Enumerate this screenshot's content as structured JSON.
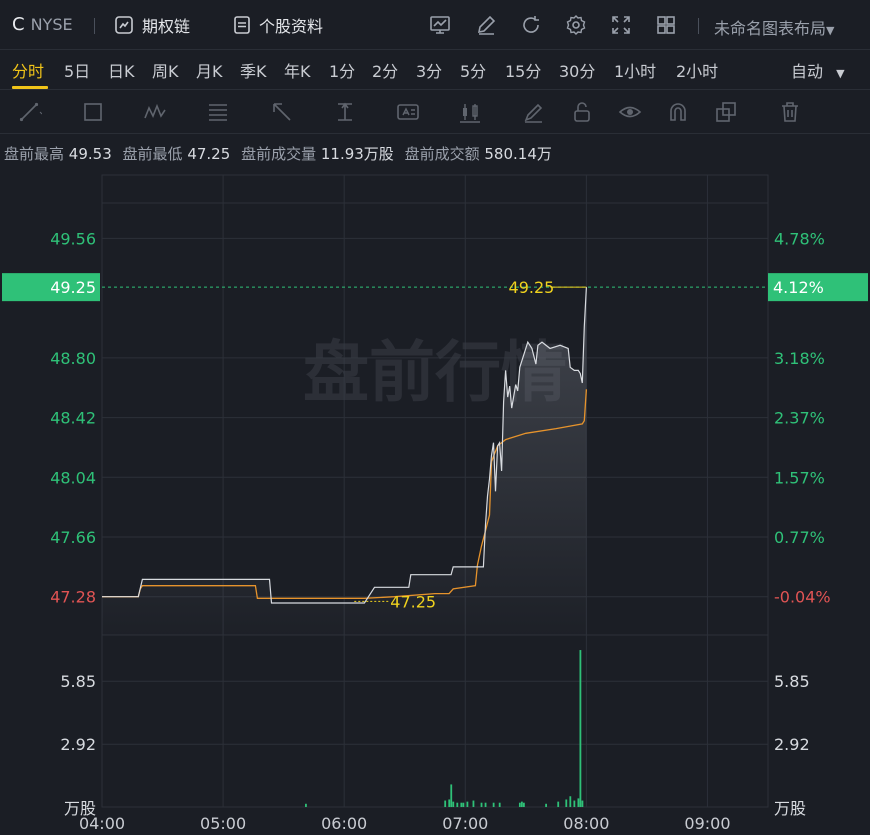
{
  "header": {
    "ticker": "C",
    "exchange": "NYSE",
    "options_label": "期权链",
    "profile_label": "个股资料",
    "layout_name": "未命名图表布局"
  },
  "timeframes": [
    "分时",
    "5日",
    "日K",
    "周K",
    "月K",
    "季K",
    "年K",
    "1分",
    "2分",
    "3分",
    "5分",
    "15分",
    "30分",
    "1小时",
    "2小时"
  ],
  "active_timeframe": 0,
  "scale_mode": "自动",
  "premarket": {
    "high_label": "盘前最高",
    "high": "49.53",
    "low_label": "盘前最低",
    "low": "47.25",
    "volume_label": "盘前成交量",
    "volume": "11.93万股",
    "amount_label": "盘前成交额",
    "amount": "580.14万"
  },
  "watermark": "盘前行情",
  "colors": {
    "background": "#1b1e25",
    "grid": "#2c3039",
    "up": "#2fc178",
    "down": "#e05454",
    "price_line": "#d8dbe0",
    "avg_line": "#e6932c",
    "label_yellow": "#f0d21e",
    "volume_bar": "#2fc178"
  },
  "chart_data": {
    "type": "line",
    "price_ticks": [
      "49.56",
      "48.80",
      "48.42",
      "48.04",
      "47.66",
      "47.28"
    ],
    "price_tick_values": [
      49.56,
      48.8,
      48.42,
      48.04,
      47.66,
      47.28
    ],
    "pct_ticks": [
      "4.78%",
      "3.18%",
      "2.37%",
      "1.57%",
      "0.77%",
      "-0.04%"
    ],
    "current_price": "49.25",
    "current_pct": "4.12%",
    "high_marker": "49.25",
    "low_marker": "47.25",
    "volume_ticks": [
      "5.85",
      "2.92"
    ],
    "volume_tick_values": [
      5.85,
      2.92
    ],
    "volume_unit": "万股",
    "time_ticks": [
      "04:00",
      "05:00",
      "06:00",
      "07:00",
      "08:00",
      "09:00"
    ],
    "time_tick_minutes": [
      240,
      300,
      360,
      420,
      480,
      540
    ],
    "x_range_minutes": [
      240,
      570
    ],
    "price_range": [
      47.1,
      49.9
    ],
    "volume_range": [
      0,
      8
    ],
    "price_series": [
      [
        240,
        47.28
      ],
      [
        258,
        47.28
      ],
      [
        260,
        47.39
      ],
      [
        285,
        47.39
      ],
      [
        323,
        47.39
      ],
      [
        324,
        47.24
      ],
      [
        340,
        47.24
      ],
      [
        370,
        47.24
      ],
      [
        375,
        47.34
      ],
      [
        392,
        47.34
      ],
      [
        393,
        47.42
      ],
      [
        413,
        47.42
      ],
      [
        414,
        47.47
      ],
      [
        429,
        47.47
      ],
      [
        430,
        47.74
      ],
      [
        431,
        47.92
      ],
      [
        432,
        48.03
      ],
      [
        433,
        48.18
      ],
      [
        434,
        48.26
      ],
      [
        435,
        47.95
      ],
      [
        436,
        48.24
      ],
      [
        437,
        48.26
      ],
      [
        438,
        48.08
      ],
      [
        439,
        48.52
      ],
      [
        440,
        48.72
      ],
      [
        441,
        48.55
      ],
      [
        442,
        48.62
      ],
      [
        443,
        48.48
      ],
      [
        445,
        48.63
      ],
      [
        446,
        48.59
      ],
      [
        447,
        48.74
      ],
      [
        448,
        48.78
      ],
      [
        449,
        48.82
      ],
      [
        450,
        48.86
      ],
      [
        451,
        48.9
      ],
      [
        453,
        48.86
      ],
      [
        455,
        48.76
      ],
      [
        456,
        48.88
      ],
      [
        458,
        48.9
      ],
      [
        462,
        48.86
      ],
      [
        467,
        48.88
      ],
      [
        471,
        48.86
      ],
      [
        472,
        48.74
      ],
      [
        474,
        48.72
      ],
      [
        476,
        48.72
      ],
      [
        477,
        48.7
      ],
      [
        478,
        48.64
      ],
      [
        479,
        49.0
      ],
      [
        480,
        49.25
      ]
    ],
    "avg_series": [
      [
        240,
        47.28
      ],
      [
        258,
        47.28
      ],
      [
        259,
        47.33
      ],
      [
        260,
        47.35
      ],
      [
        300,
        47.35
      ],
      [
        316,
        47.35
      ],
      [
        317,
        47.27
      ],
      [
        370,
        47.27
      ],
      [
        385,
        47.28
      ],
      [
        405,
        47.3
      ],
      [
        412,
        47.3
      ],
      [
        414,
        47.33
      ],
      [
        425,
        47.35
      ],
      [
        426,
        47.48
      ],
      [
        428,
        47.6
      ],
      [
        430,
        47.7
      ],
      [
        432,
        47.8
      ],
      [
        433,
        48.14
      ],
      [
        436,
        48.24
      ],
      [
        440,
        48.28
      ],
      [
        450,
        48.32
      ],
      [
        465,
        48.35
      ],
      [
        478,
        48.38
      ],
      [
        479,
        48.4
      ],
      [
        480,
        48.6
      ]
    ],
    "volume_bars": [
      [
        341,
        0.15
      ],
      [
        410,
        0.3
      ],
      [
        412,
        0.35
      ],
      [
        413,
        1.05
      ],
      [
        414,
        0.25
      ],
      [
        416,
        0.2
      ],
      [
        418,
        0.2
      ],
      [
        419,
        0.2
      ],
      [
        421,
        0.25
      ],
      [
        424,
        0.3
      ],
      [
        428,
        0.2
      ],
      [
        430,
        0.2
      ],
      [
        434,
        0.2
      ],
      [
        437,
        0.2
      ],
      [
        447,
        0.2
      ],
      [
        448,
        0.25
      ],
      [
        449,
        0.2
      ],
      [
        460,
        0.15
      ],
      [
        466,
        0.25
      ],
      [
        470,
        0.35
      ],
      [
        472,
        0.5
      ],
      [
        474,
        0.3
      ],
      [
        476,
        0.4
      ],
      [
        477,
        7.3
      ],
      [
        478,
        0.3
      ]
    ]
  }
}
